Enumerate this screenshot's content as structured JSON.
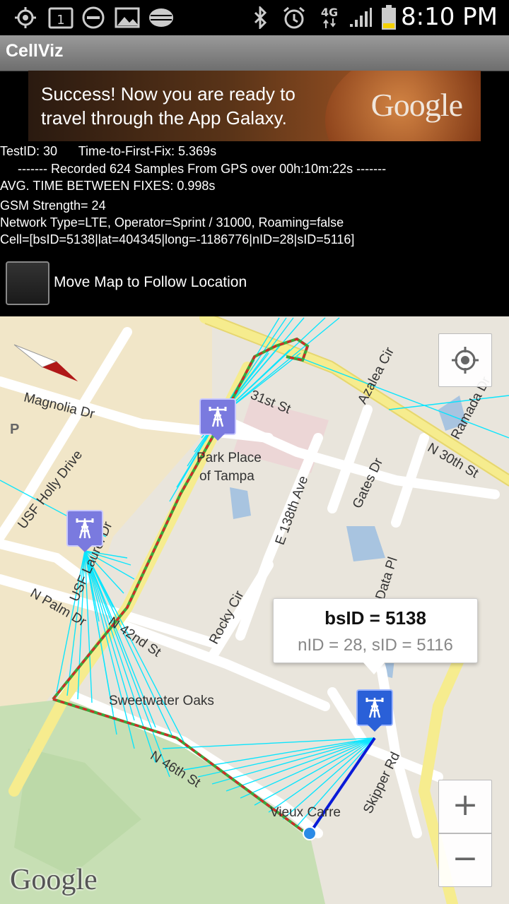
{
  "status_bar": {
    "time": "8:10 PM",
    "network": "4G",
    "icons": [
      "gps-icon",
      "calendar-icon",
      "do-not-disturb-icon",
      "gallery-icon",
      "wifi-icon",
      "bluetooth-icon",
      "alarm-icon",
      "data-arrows-icon",
      "signal-icon",
      "battery-icon"
    ],
    "calendar_day": "1"
  },
  "app": {
    "title": "CellViz"
  },
  "ad": {
    "message": "Success! Now you are ready to travel through the App Galaxy.",
    "logo": "Google"
  },
  "info": {
    "line1": "TestID: 30      Time-to-First-Fix: 5.369s",
    "line2": "     ------- Recorded 624 Samples From GPS over 00h:10m:22s -------",
    "line3": "AVG. TIME BETWEEN FIXES: 0.998s",
    "line4": "GSM Strength= 24",
    "line5": "Network Type=LTE, Operator=Sprint / 31000, Roaming=false",
    "line6": "Cell=[bsID=5138|lat=404345|long=-1186776|nID=28|sID=5116]"
  },
  "follow_checkbox": {
    "label": "Move Map to Follow Location",
    "checked": false
  },
  "map": {
    "labels": {
      "magnolia": "Magnolia Dr",
      "parking": "P",
      "st31": "31st St",
      "azalea": "Azalea Cir",
      "ramada": "Ramada Dr",
      "n30th": "N 30th St",
      "park1": "Park Place",
      "park2": "of Tampa",
      "holly": "USF Holly Drive",
      "e138": "E 138th Ave",
      "gates": "Gates Dr",
      "laurel": "USF Laurel Dr",
      "datapl": "Data Pl",
      "npalm": "N Palm Dr",
      "rocky": "Rocky Cir",
      "n42": "N 42nd St",
      "sweetwater": "Sweetwater Oaks",
      "n46": "N 46th St",
      "skipper": "Skipper Rd",
      "vieux": "Vieux Carre",
      "google": "Google"
    },
    "bubble": {
      "title": "bsID = 5138",
      "subtitle": "nID = 28, sID = 5116"
    },
    "zoom_in": "+",
    "zoom_out": "−",
    "colors": {
      "ray": "#00e5ff",
      "track_red": "#d8262a",
      "track_green": "#3aa83a",
      "active_ray": "#0a1ad8"
    }
  }
}
